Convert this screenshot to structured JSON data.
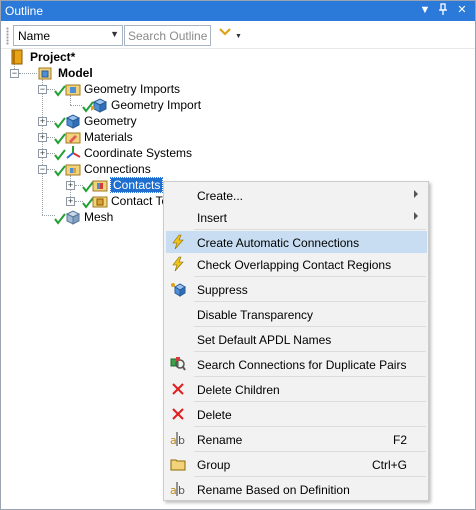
{
  "window": {
    "title": "Outline"
  },
  "toolbar": {
    "filter_value": "Name",
    "search_placeholder": "Search Outline"
  },
  "tree": {
    "project": "Project*",
    "model": "Model",
    "geometry_imports": "Geometry Imports",
    "geometry_import": "Geometry Import",
    "geometry": "Geometry",
    "materials": "Materials",
    "coordinate_systems": "Coordinate Systems",
    "connections": "Connections",
    "contacts": "Contacts",
    "contact_tool": "Contact To",
    "mesh": "Mesh"
  },
  "menu": {
    "create": "Create...",
    "insert": "Insert",
    "create_auto": "Create Automatic Connections",
    "check_overlap": "Check Overlapping Contact Regions",
    "suppress": "Suppress",
    "disable_transparency": "Disable Transparency",
    "set_apdl": "Set Default APDL Names",
    "search_dup": "Search Connections for Duplicate Pairs",
    "delete_children": "Delete Children",
    "delete": "Delete",
    "rename": "Rename",
    "rename_shortcut": "F2",
    "group": "Group",
    "group_shortcut": "Ctrl+G",
    "rename_def": "Rename Based on Definition"
  },
  "colors": {
    "title_bar": "#2b79d9",
    "selection": "#1f6fd1",
    "menu_highlight": "#c8ddf2",
    "check_green": "#22a033",
    "delete_red": "#e01e1e"
  }
}
